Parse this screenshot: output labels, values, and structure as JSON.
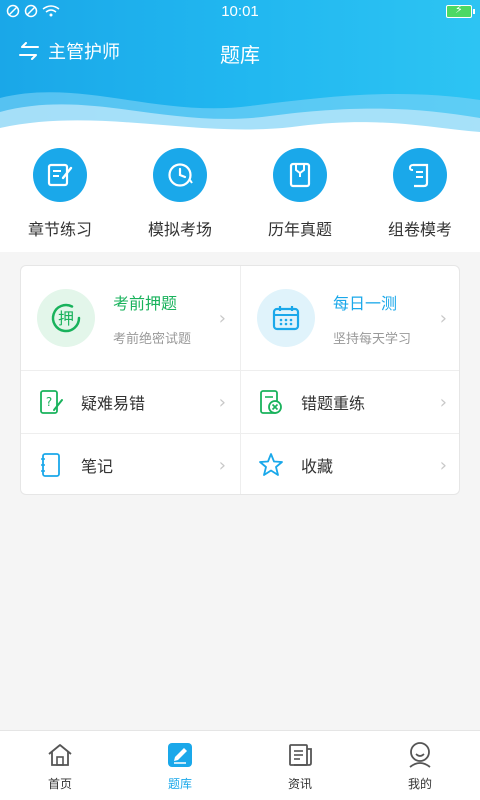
{
  "status_bar": {
    "time": "10:01"
  },
  "header": {
    "switch_label": "主管护师",
    "title": "题库"
  },
  "quick_menu": [
    {
      "label": "章节练习",
      "icon": "edit-note-icon"
    },
    {
      "label": "模拟考场",
      "icon": "clock-icon"
    },
    {
      "label": "历年真题",
      "icon": "document-folder-icon"
    },
    {
      "label": "组卷模考",
      "icon": "scroll-icon"
    }
  ],
  "features": {
    "predict": {
      "title": "考前押题",
      "subtitle": "考前绝密试题",
      "badge": "押",
      "color": "#19b25c"
    },
    "daily": {
      "title": "每日一测",
      "subtitle": "坚持每天学习",
      "color": "#1aa8ea"
    },
    "difficult": {
      "label": "疑难易错"
    },
    "wrong_retry": {
      "label": "错题重练"
    },
    "notes": {
      "label": "笔记"
    },
    "favorites": {
      "label": "收藏"
    }
  },
  "tab_bar": [
    {
      "label": "首页",
      "icon": "home-icon"
    },
    {
      "label": "题库",
      "icon": "question-bank-icon",
      "active": true
    },
    {
      "label": "资讯",
      "icon": "news-icon"
    },
    {
      "label": "我的",
      "icon": "user-icon"
    }
  ],
  "colors": {
    "accent": "#1aa8ea",
    "green": "#19b25c"
  }
}
